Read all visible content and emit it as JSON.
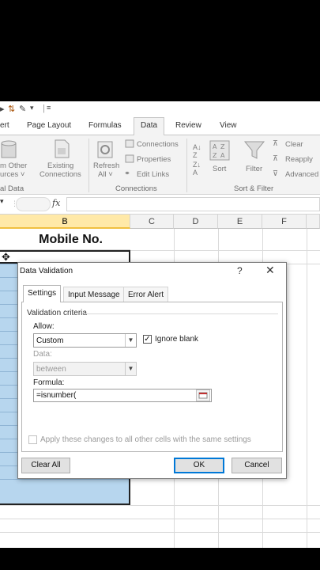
{
  "ribbon_tabs": [
    "ert",
    "Page Layout",
    "Formulas",
    "Data",
    "Review",
    "View"
  ],
  "ribbon": {
    "get_external": {
      "line1": "m Other",
      "line2": "urces ˅"
    },
    "existing": {
      "line1": "Existing",
      "line2": "Connections"
    },
    "refresh": {
      "line1": "Refresh",
      "line2": "All ˅"
    },
    "connections_items": [
      "Connections",
      "Properties",
      "Edit Links"
    ],
    "sort": "Sort",
    "filter": "Filter",
    "filter_items": [
      "Clear",
      "Reapply",
      "Advanced"
    ],
    "groups": [
      "al Data",
      "Connections",
      "Sort & Filter"
    ]
  },
  "formula_bar": {
    "fx": "fx"
  },
  "columns": [
    "B",
    "C",
    "D",
    "E",
    "F"
  ],
  "cell_b1": "Mobile No.",
  "dialog": {
    "title": "Data Validation",
    "help": "?",
    "close": "✕",
    "tabs": [
      "Settings",
      "Input Message",
      "Error Alert"
    ],
    "criteria_legend": "Validation criteria",
    "allow_label": "Allow:",
    "allow_value": "Custom",
    "ignore_blank_label": "Ignore blank",
    "ignore_blank_checked": true,
    "data_label": "Data:",
    "data_value": "between",
    "formula_label": "Formula:",
    "formula_value": "=isnumber(",
    "apply_label": "Apply these changes to all other cells with the same settings",
    "clear_all": "Clear All",
    "ok": "OK",
    "cancel": "Cancel"
  },
  "colors": {
    "selection_fill": "#b7d6ee",
    "selected_header": "#ffe9a8",
    "ok_border": "#0078d7"
  }
}
